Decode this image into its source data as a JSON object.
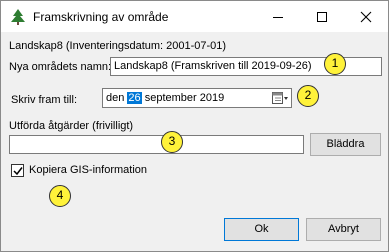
{
  "window": {
    "title": "Framskrivning av område",
    "app_icon": "tree-icon",
    "controls": {
      "minimize": "minimize-icon",
      "maximize": "maximize-icon",
      "close": "close-icon"
    }
  },
  "info": {
    "text": "Landskap8 (Inventeringsdatum: 2001-07-01)"
  },
  "name_field": {
    "label": "Nya områdets namn:",
    "value": "Landskap8 (Framskriven till 2019-09-26)"
  },
  "date_field": {
    "label": "Skriv fram till:",
    "value_prefix": "den ",
    "value_selected": "26",
    "value_suffix": " september 2019",
    "icon": "calendar-dropdown-icon"
  },
  "actions_field": {
    "label": "Utförda åtgärder (frivilligt)",
    "value": "",
    "browse_label": "Bläddra"
  },
  "copy_gis": {
    "label": "Kopiera GIS-information",
    "checked": true
  },
  "buttons": {
    "ok": "Ok",
    "cancel": "Avbryt"
  },
  "callouts": [
    "1",
    "2",
    "3",
    "4"
  ],
  "colors": {
    "selection": "#0078d7",
    "callout": "#fff23a",
    "dialog_bg": "#f0f0f0"
  }
}
